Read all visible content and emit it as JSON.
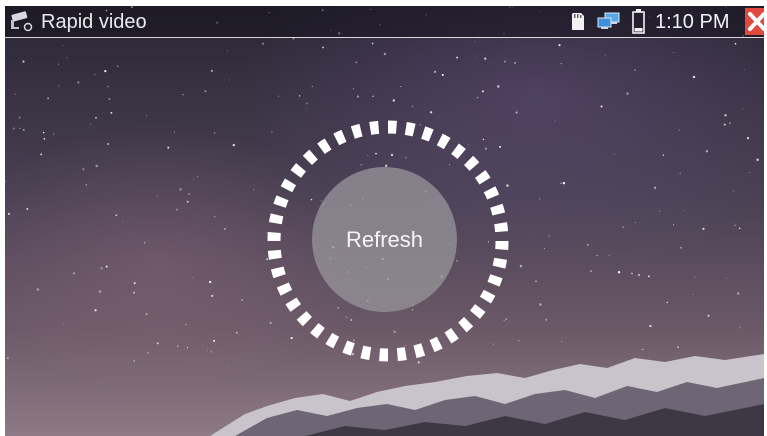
{
  "status_bar": {
    "app_icon": "cctv-camera-icon",
    "title": "Rapid video",
    "sd_icon": "sd-card-icon",
    "network_icon": "network-computers-icon",
    "battery_icon": "battery-icon",
    "time": "1:10 PM",
    "close_icon": "close-icon",
    "close_color": "#e04a3e"
  },
  "main": {
    "background": "night-sky-milky-way-mountain",
    "refresh_label": "Refresh",
    "ring_icon": "loading-ring-icon",
    "ring_color": "#ffffff",
    "button_color": "#96929a"
  }
}
